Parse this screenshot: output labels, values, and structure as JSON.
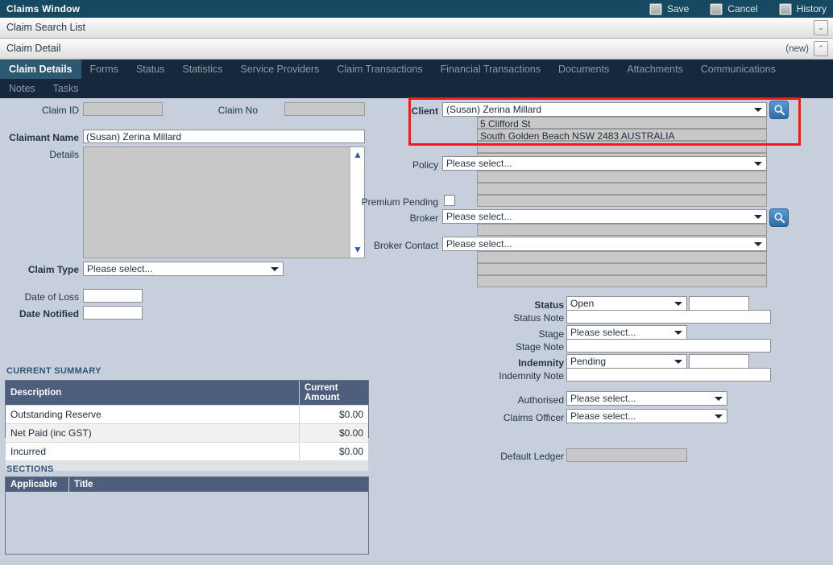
{
  "window": {
    "title": "Claims Window",
    "toolbar": [
      {
        "label": "Save",
        "icon": "save-icon"
      },
      {
        "label": "Cancel",
        "icon": "cancel-icon"
      },
      {
        "label": "History",
        "icon": "history-icon"
      }
    ]
  },
  "bars": {
    "search_list": "Claim Search List",
    "detail": "Claim Detail",
    "detail_tag": "(new)",
    "chevron_down": "⌄",
    "chevron_up": "⌃"
  },
  "tabs": {
    "row1": [
      {
        "label": "Claim Details",
        "active": true
      },
      {
        "label": "Forms",
        "active": false
      },
      {
        "label": "Status",
        "active": false
      },
      {
        "label": "Statistics",
        "active": false
      },
      {
        "label": "Service Providers",
        "active": false
      },
      {
        "label": "Claim Transactions",
        "active": false
      },
      {
        "label": "Financial Transactions",
        "active": false
      },
      {
        "label": "Documents",
        "active": false
      },
      {
        "label": "Attachments",
        "active": false
      },
      {
        "label": "Communications",
        "active": false
      }
    ],
    "row2": [
      {
        "label": "Notes",
        "active": false
      },
      {
        "label": "Tasks",
        "active": false
      }
    ]
  },
  "left": {
    "claim_id_label": "Claim ID",
    "claim_id_value": "",
    "claim_no_label": "Claim No",
    "claim_no_value": "",
    "claimant_name_label": "Claimant Name",
    "claimant_name_value": "(Susan) Zerina Millard",
    "details_label": "Details",
    "details_value": "",
    "claim_type_label": "Claim Type",
    "claim_type_value": "Please select...",
    "date_of_loss_label": "Date of Loss",
    "date_of_loss_value": "",
    "date_notified_label": "Date Notified",
    "date_notified_value": ""
  },
  "right": {
    "client_label": "Client",
    "client_value": "(Susan) Zerina Millard",
    "client_address_1": "5 Clifford St",
    "client_address_2": "South Golden Beach NSW 2483 AUSTRALIA",
    "client_address_3": "",
    "client_address_4": "",
    "policy_label": "Policy",
    "policy_value": "Please select...",
    "policy_row_1": "",
    "policy_row_2": "",
    "policy_row_3": "",
    "premium_pending_label": "Premium Pending",
    "premium_pending_checked": false,
    "broker_label": "Broker",
    "broker_value": "Please select...",
    "broker_row_1": "",
    "broker_contact_label": "Broker Contact",
    "broker_contact_value": "Please select...",
    "broker_contact_row_1": "",
    "broker_contact_row_2": "",
    "broker_contact_row_3": "",
    "status_label": "Status",
    "status_value": "Open",
    "status_extra": "",
    "status_note_label": "Status Note",
    "status_note_value": "",
    "stage_label": "Stage",
    "stage_value": "Please select...",
    "stage_note_label": "Stage Note",
    "stage_note_value": "",
    "indemnity_label": "Indemnity",
    "indemnity_value": "Pending",
    "indemnity_extra": "",
    "indemnity_note_label": "Indemnity Note",
    "indemnity_note_value": "",
    "authorised_label": "Authorised",
    "authorised_value": "Please select...",
    "claims_officer_label": "Claims Officer",
    "claims_officer_value": "Please select...",
    "default_ledger_label": "Default Ledger",
    "default_ledger_value": ""
  },
  "current_summary": {
    "caption": "CURRENT SUMMARY",
    "columns": [
      "Description",
      "Current Amount"
    ],
    "rows": [
      [
        "Outstanding Reserve",
        "$0.00"
      ],
      [
        "Net Paid (inc GST)",
        "$0.00"
      ],
      [
        "Incurred",
        "$0.00"
      ]
    ]
  },
  "sections": {
    "caption": "SECTIONS",
    "columns": [
      "Applicable",
      "Title"
    ],
    "rows": []
  },
  "colors": {
    "titlebar": "#164a63",
    "tabbar": "#16283b",
    "active_tab": "#2c5871",
    "body": "#c7cfdd",
    "table_header": "#4e5f7e",
    "highlight": "#ee1b1b",
    "accent_blue": "#2f5fa8"
  }
}
